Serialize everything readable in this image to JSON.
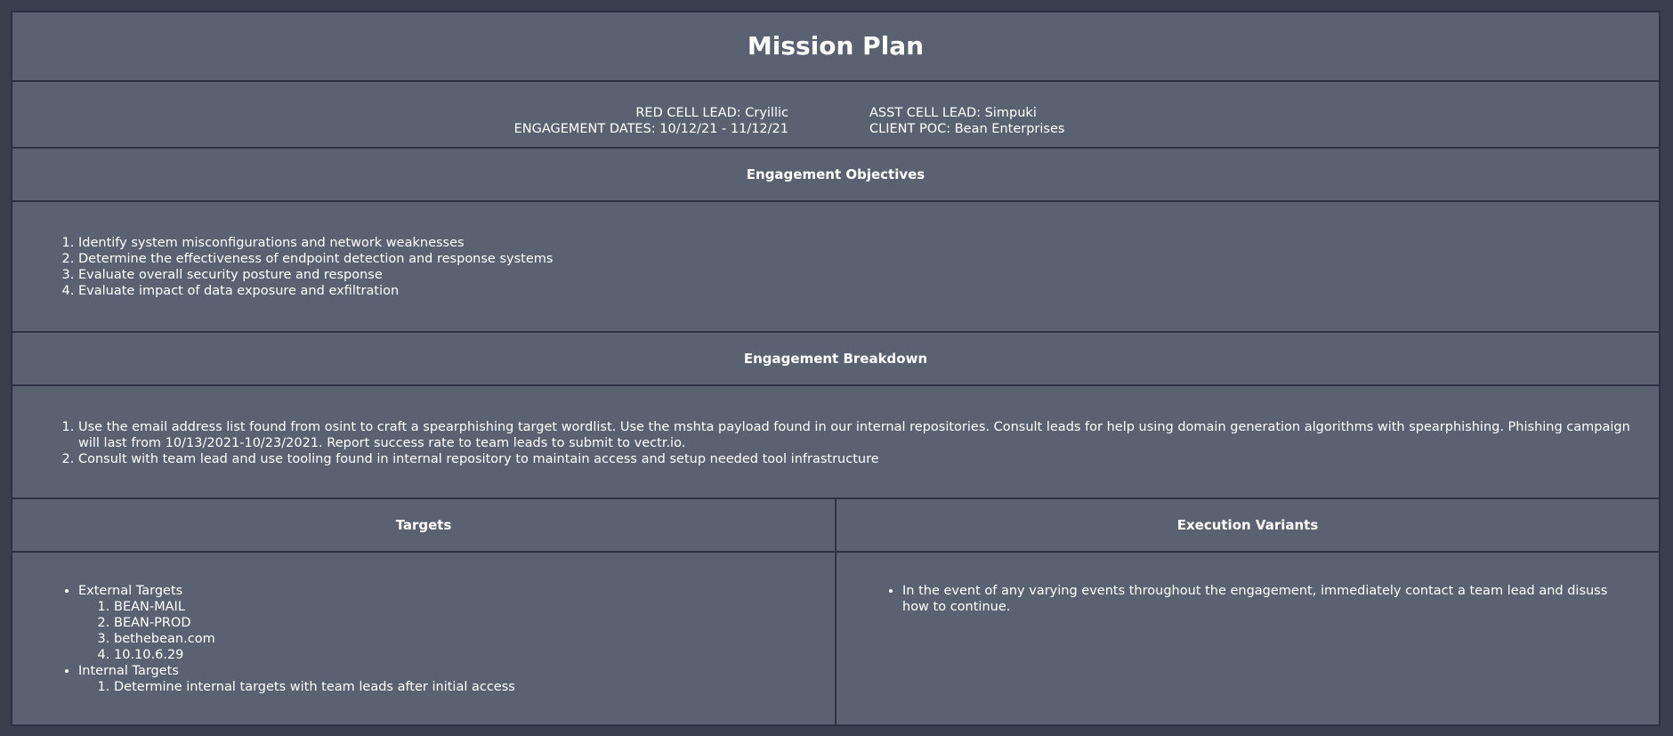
{
  "title": "Mission Plan",
  "leads": {
    "red_cell_lead": "RED CELL LEAD: Cryillic",
    "engagement_dates": "ENGAGEMENT DATES: 10/12/21 - 11/12/21",
    "asst_cell_lead": "ASST CELL LEAD: Simpuki",
    "client_poc": "CLIENT POC: Bean Enterprises"
  },
  "objectives": {
    "heading": "Engagement Objectives",
    "items": [
      "Identify system misconfigurations and network weaknesses",
      "Determine the effectiveness of endpoint detection and response systems",
      "Evaluate overall security posture and response",
      "Evaluate impact of data exposure and exfiltration"
    ]
  },
  "breakdown": {
    "heading": "Engagement Breakdown",
    "items": [
      "Use the email address list found from osint to craft a spearphishing target wordlist. Use the mshta payload found in our internal repositories. Consult leads for help using domain generation algorithms with spearphishing. Phishing campaign will last from 10/13/2021-10/23/2021. Report success rate to team leads to submit to vectr.io.",
      "Consult with team lead and use tooling found in internal repository to maintain access and setup needed tool infrastructure"
    ]
  },
  "targets": {
    "heading": "Targets",
    "external_label": "External Targets",
    "external_items": [
      "BEAN-MAIL",
      "BEAN-PROD",
      "bethebean.com",
      "10.10.6.29"
    ],
    "internal_label": "Internal Targets",
    "internal_items": [
      "Determine internal targets with team leads after initial access"
    ]
  },
  "variants": {
    "heading": "Execution Variants",
    "items": [
      "In the event of any varying events throughout the engagement, immediately contact a team lead and disuss how to continue."
    ]
  }
}
